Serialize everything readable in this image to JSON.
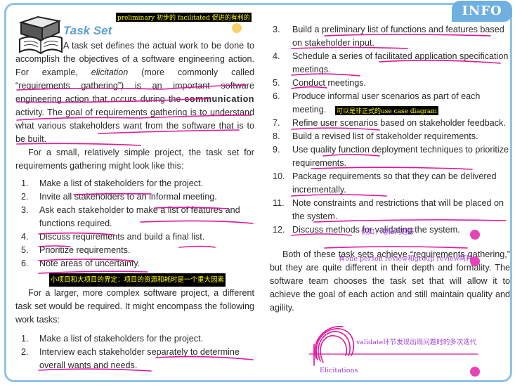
{
  "badge": "INFO",
  "title": "Task Set",
  "highlight_top": "preliminary 初步的 facilitated 促进的有利的",
  "intro": {
    "first": "A task set defines the actual work to be done to accomplish the objectives of a software engineering action. For example, ",
    "elicitation": "elicitation",
    "middle": " (more commonly called “requirements gathering”) is an important software engineering action that occurs during the ",
    "communication": "communication",
    "last": " activity. The goal of requirements gathering is to understand what various stakeholders want from the software that is to be built."
  },
  "small_intro": "For a small, relatively simple project, the task set for requirements gathering might look like this:",
  "small_tasks": [
    {
      "n": "1.",
      "text": "Make a list of stakeholders for the project."
    },
    {
      "n": "2.",
      "text": "Invite all stakeholders to an informal meeting."
    },
    {
      "n": "3.",
      "text": "Ask each stakeholder to make a list of features and functions required."
    },
    {
      "n": "4.",
      "text": "Discuss requirements and build a final list."
    },
    {
      "n": "5.",
      "text": "Prioritize requirements."
    },
    {
      "n": "6.",
      "text": "Note areas of uncertainty."
    }
  ],
  "highlight_mid": "小项目和大项目的界定：项目的资源和耗时是一个重大因素",
  "large_intro": "For a larger, more complex software project, a different task set would be required. It might encompass the following work tasks:",
  "large_tasks_left": [
    {
      "n": "1.",
      "text": "Make a list of stakeholders for the project."
    },
    {
      "n": "2.",
      "text": "Interview each stakeholder separately to determine overall wants and needs."
    }
  ],
  "large_tasks_right": [
    {
      "n": "3.",
      "text": "Build a preliminary list of functions and features based on stakeholder input."
    },
    {
      "n": "4.",
      "text": "Schedule a series of facilitated application specification meetings."
    },
    {
      "n": "5.",
      "text": "Conduct meetings."
    },
    {
      "n": "6.",
      "text": "Produce informal user scenarios as part of each meeting."
    },
    {
      "n": "7.",
      "text": "Refine user scenarios based on stakeholder feedback."
    },
    {
      "n": "8.",
      "text": "Build a revised list of stakeholder requirements."
    },
    {
      "n": "9.",
      "text": "Use quality function deployment techniques to prioritize requirements."
    },
    {
      "n": "10.",
      "text": "Package requirements so that they can be delivered incrementally."
    },
    {
      "n": "11.",
      "text": "Note constraints and restrictions that will be placed on the system."
    },
    {
      "n": "12.",
      "text": "Discuss methods for validating the system."
    }
  ],
  "highlight_item6": "可以是非正式的use case diagram",
  "note_item11": "例如：隐私问题等",
  "note_review": "有one person review和group review两种",
  "conclusion": "Both of these task sets achieve “requirements gathering,” but they are quite different in their depth and formality. The software team chooses the task set that will allow it to achieve the goal of each action and still maintain quality and agility.",
  "note_validate": "validate环节发现出现问题时的多次迭代",
  "note_elicitations": "Elicitations",
  "colors": {
    "frame": "#8fc3e8",
    "title": "#5e9fd0",
    "ink": "#e0169a",
    "note": "#9b3bd6",
    "highlight_bg": "#000000",
    "highlight_fg": "#ffff00"
  }
}
